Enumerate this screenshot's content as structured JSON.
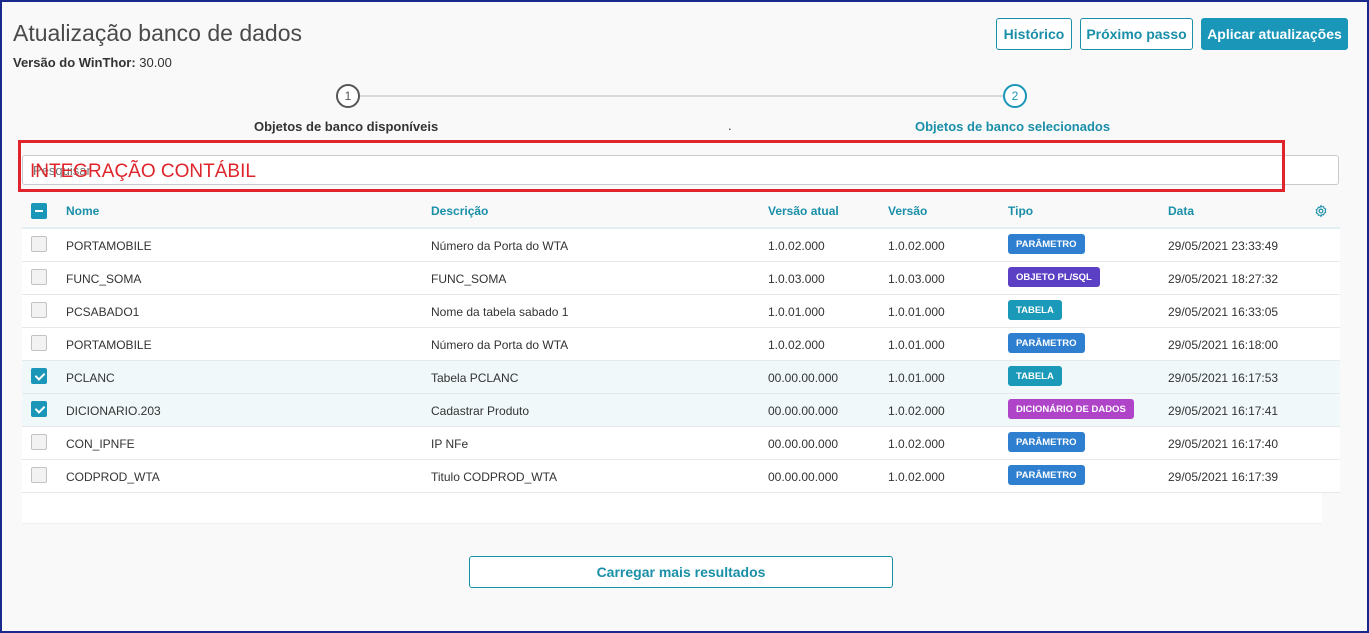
{
  "header": {
    "title": "Atualização banco de dados",
    "version_label": "Versão do WinThor:",
    "version_value": "30.00",
    "buttons": {
      "historico": "Histórico",
      "proximo": "Próximo passo",
      "aplicar": "Aplicar atualizações"
    }
  },
  "stepper": {
    "steps": [
      {
        "number": "1",
        "label": "Objetos de banco disponíveis"
      },
      {
        "number": "2",
        "label": "Objetos de banco selecionados"
      }
    ],
    "separator": "."
  },
  "search": {
    "placeholder": "Pesquisar"
  },
  "annotation": {
    "label": "INTEGRAÇÃO CONTÁBIL",
    "color": "#e0242b"
  },
  "table": {
    "columns": [
      "Nome",
      "Descrição",
      "Versão atual",
      "Versão",
      "Tipo",
      "Data"
    ],
    "rows": [
      {
        "checked": false,
        "nome": "PORTAMOBILE",
        "descricao": "Número da Porta do WTA",
        "versao_atual": "1.0.02.000",
        "versao": "1.0.02.000",
        "tipo": "PARÂMETRO",
        "tipo_color": "#2e7fd0",
        "data": "29/05/2021 23:33:49"
      },
      {
        "checked": false,
        "nome": "FUNC_SOMA",
        "descricao": "FUNC_SOMA",
        "versao_atual": "1.0.03.000",
        "versao": "1.0.03.000",
        "tipo": "OBJETO PL/SQL",
        "tipo_color": "#5b3fc4",
        "data": "29/05/2021 18:27:32"
      },
      {
        "checked": false,
        "nome": "PCSABADO1",
        "descricao": "Nome da tabela sabado 1",
        "versao_atual": "1.0.01.000",
        "versao": "1.0.01.000",
        "tipo": "TABELA",
        "tipo_color": "#1a9ab8",
        "data": "29/05/2021 16:33:05"
      },
      {
        "checked": false,
        "nome": "PORTAMOBILE",
        "descricao": "Número da Porta do WTA",
        "versao_atual": "1.0.02.000",
        "versao": "1.0.01.000",
        "tipo": "PARÂMETRO",
        "tipo_color": "#2e7fd0",
        "data": "29/05/2021 16:18:00"
      },
      {
        "checked": true,
        "nome": "PCLANC",
        "descricao": "Tabela PCLANC",
        "versao_atual": "00.00.00.000",
        "versao": "1.0.01.000",
        "tipo": "TABELA",
        "tipo_color": "#1a9ab8",
        "data": "29/05/2021 16:17:53"
      },
      {
        "checked": true,
        "nome": "DICIONARIO.203",
        "descricao": "Cadastrar Produto",
        "versao_atual": "00.00.00.000",
        "versao": "1.0.02.000",
        "tipo": "DICIONÁRIO DE DADOS",
        "tipo_color": "#b044c8",
        "data": "29/05/2021 16:17:41"
      },
      {
        "checked": false,
        "nome": "CON_IPNFE",
        "descricao": "IP NFe",
        "versao_atual": "00.00.00.000",
        "versao": "1.0.02.000",
        "tipo": "PARÂMETRO",
        "tipo_color": "#2e7fd0",
        "data": "29/05/2021 16:17:40"
      },
      {
        "checked": false,
        "nome": "CODPROD_WTA",
        "descricao": "Titulo CODPROD_WTA",
        "versao_atual": "00.00.00.000",
        "versao": "1.0.02.000",
        "tipo": "PARÂMETRO",
        "tipo_color": "#2e7fd0",
        "data": "29/05/2021 16:17:39"
      }
    ]
  },
  "load_more": "Carregar mais resultados"
}
